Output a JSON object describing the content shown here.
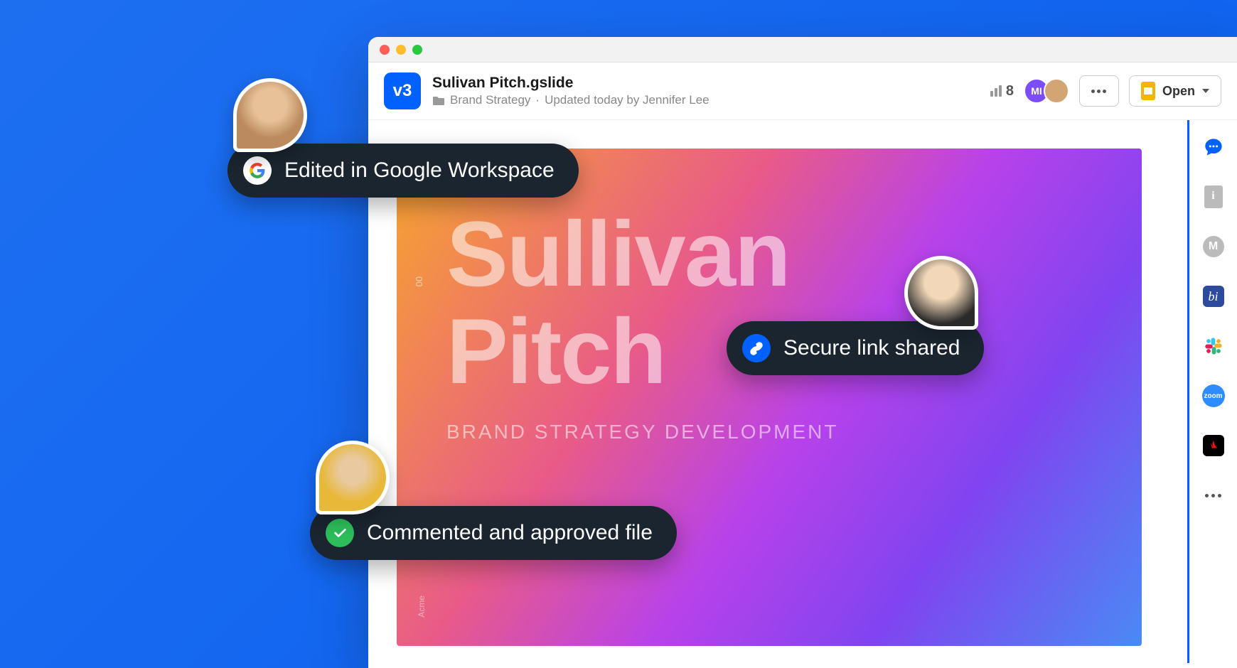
{
  "header": {
    "version": "v3",
    "filename": "Sulivan Pitch.gslide",
    "folder": "Brand Strategy",
    "updated_text": "Updated today by Jennifer Lee",
    "views_count": "8",
    "avatar_initials": "MI",
    "open_label": "Open"
  },
  "slide": {
    "page_number": "00",
    "title_line1": "Sullivan",
    "title_line2": "Pitch",
    "subtitle": "BRAND STRATEGY DEVELOPMENT",
    "footer_label": "Acme"
  },
  "annotations": {
    "edited": "Edited in Google Workspace",
    "shared": "Secure link shared",
    "approved": "Commented and approved file"
  },
  "rail": {
    "zoom_label": "zoom",
    "m_label": "M",
    "bi_label": "bi"
  }
}
